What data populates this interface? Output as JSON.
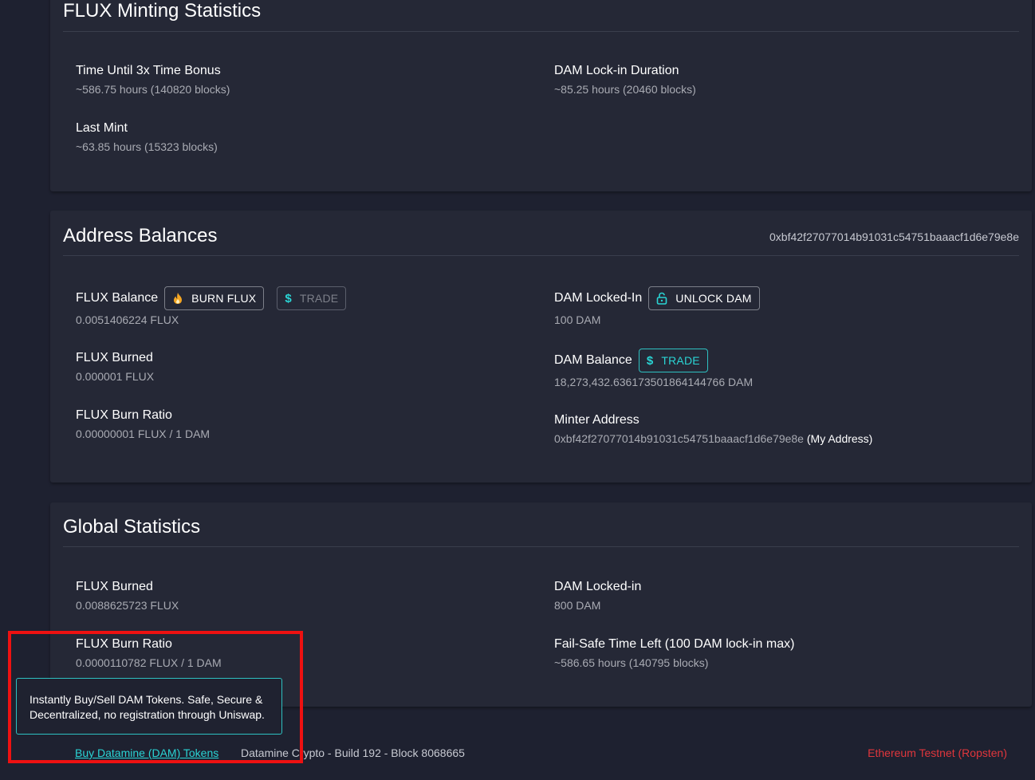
{
  "minting": {
    "title": "FLUX Minting Statistics",
    "stats": [
      {
        "label": "Time Until 3x Time Bonus",
        "value": "~586.75 hours (140820 blocks)"
      },
      {
        "label": "DAM Lock-in Duration",
        "value": "~85.25 hours (20460 blocks)"
      },
      {
        "label": "Last Mint",
        "value": "~63.85 hours (15323 blocks)"
      }
    ]
  },
  "balances": {
    "title": "Address Balances",
    "address": "0xbf42f27077014b91031c54751baaacf1d6e79e8e",
    "flux_balance": {
      "label": "FLUX Balance",
      "value": "0.0051406224 FLUX",
      "burn_button": "BURN FLUX",
      "trade_button": "TRADE"
    },
    "flux_burned": {
      "label": "FLUX Burned",
      "value": "0.000001 FLUX"
    },
    "flux_burn_ratio": {
      "label": "FLUX Burn Ratio",
      "value": "0.00000001 FLUX / 1 DAM"
    },
    "dam_locked": {
      "label": "DAM Locked-In",
      "value": "100 DAM",
      "unlock_button": "UNLOCK DAM"
    },
    "dam_balance": {
      "label": "DAM Balance",
      "value": "18,273,432.636173501864144766 DAM",
      "trade_button": "TRADE"
    },
    "minter_address": {
      "label": "Minter Address",
      "value": "0xbf42f27077014b91031c54751baaacf1d6e79e8e",
      "suffix": "(My Address)"
    }
  },
  "global": {
    "title": "Global Statistics",
    "flux_burned": {
      "label": "FLUX Burned",
      "value": "0.0088625723 FLUX"
    },
    "flux_burn_ratio": {
      "label": "FLUX Burn Ratio",
      "value": "0.0000110782 FLUX / 1 DAM"
    },
    "dam_locked": {
      "label": "DAM Locked-in",
      "value": "800 DAM"
    },
    "failsafe": {
      "label": "Fail-Safe Time Left (100 DAM lock-in max)",
      "value": "~586.65 hours (140795 blocks)"
    }
  },
  "footer": {
    "buy_link": "Buy Datamine (DAM) Tokens",
    "build_text": "Datamine Crypto - Build 192 - Block 8068665",
    "network": "Ethereum Testnet (Ropsten)"
  },
  "tooltip": {
    "text": "Instantly Buy/Sell DAM Tokens. Safe, Secure & Decentralized, no registration through Uniswap."
  },
  "colors": {
    "background": "#1e2130",
    "card": "#252836",
    "accent": "#2ad4d4",
    "network": "#e0363c",
    "highlight": "#ee1111",
    "fire": "#f5a623"
  },
  "icons": {
    "burn": "fire-icon",
    "trade": "dollar-icon",
    "unlock": "unlock-icon"
  }
}
